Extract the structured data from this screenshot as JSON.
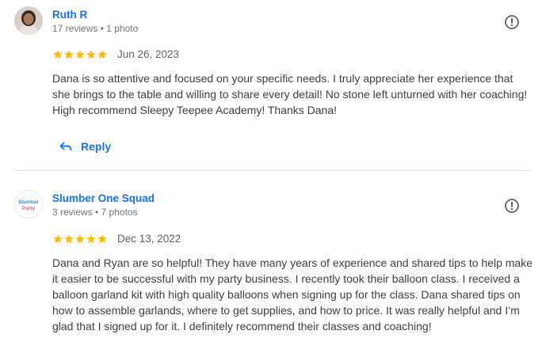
{
  "reviews": [
    {
      "author": "Ruth R",
      "meta": "17 reviews • 1 photo",
      "rating": 5,
      "date": "Jun 26, 2023",
      "text": "Dana is so attentive and focused on your specific needs. I truly appreciate her experience that she brings to the table and willing to share every detail! No stone left unturned with her coaching! High recommend Sleepy Teepee Academy! Thanks Dana!",
      "reply_label": "Reply",
      "avatar_icon": "person-photo-avatar",
      "flag_icon": "report-icon"
    },
    {
      "author": "Slumber One Squad",
      "meta": "3 reviews • 7 photos",
      "rating": 5,
      "date": "Dec 13, 2022",
      "text": "Dana and Ryan are so helpful! They have many years of experience and shared tips to help make it easier to be successful with my party business. I recently took their balloon class. I received a balloon garland kit with high quality balloons when signing up for the class. Dana shared tips on how to assemble garlands, where to get supplies, and how to price. It was really helpful and I’m glad that I signed up for it. I definitely recommend their classes and coaching!",
      "avatar_icon": "slumber-party-logo-avatar",
      "avatar_logo_text": "Slumber Party",
      "flag_icon": "report-icon"
    }
  ],
  "colors": {
    "star": "#fbbc04",
    "link": "#1a73e8",
    "divider": "#e0e0e0"
  }
}
